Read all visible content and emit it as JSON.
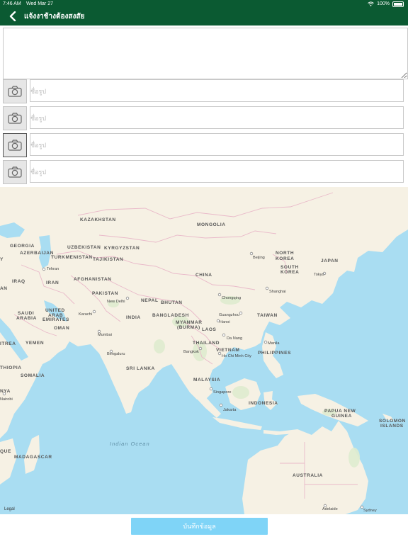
{
  "status_bar": {
    "time": "7:46 AM",
    "date": "Wed Mar 27",
    "battery": "100%"
  },
  "header": {
    "title": "แจ้งงาช้างต้องสงสัย"
  },
  "photos": {
    "rows": [
      {
        "placeholder": "ชื่อรูป"
      },
      {
        "placeholder": "ชื่อรูป"
      },
      {
        "placeholder": "ชื่อรูป"
      },
      {
        "placeholder": "ชื่อรูป"
      }
    ]
  },
  "map": {
    "countries": {
      "kazakhstan": "KAZAKHSTAN",
      "mongolia": "MONGOLIA",
      "georgia": "GEORGIA",
      "azerbaijan": "AZERBAIJAN",
      "uzbekistan": "UZBEKISTAN",
      "kyrgyzstan": "KYRGYZSTAN",
      "turkmenistan": "TURKMENISTAN",
      "tajikistan": "TAJIKISTAN",
      "iraq": "IRAQ",
      "iran": "IRAN",
      "afghanistan": "AFGHANISTAN",
      "pakistan": "PAKISTAN",
      "china": "CHINA",
      "north_korea_1": "NORTH",
      "north_korea_2": "KOREA",
      "south_korea_1": "SOUTH",
      "south_korea_2": "KOREA",
      "japan": "JAPAN",
      "nepal": "NEPAL",
      "bhutan": "BHUTAN",
      "saudi_1": "SAUDI",
      "saudi_2": "ARABIA",
      "uae_1": "UNITED",
      "uae_2": "ARAB",
      "uae_3": "EMIRATES",
      "india": "INDIA",
      "bangladesh": "BANGLADESH",
      "taiwan": "TAIWAN",
      "oman": "OMAN",
      "myanmar_1": "MYANMAR",
      "myanmar_2": "(BURMA)",
      "laos": "LAOS",
      "yemen": "YEMEN",
      "thailand": "THAILAND",
      "vietnam": "VIETNAM",
      "philippines": "PHILIPPINES",
      "eritrea": "ITREA",
      "ethiopia": "THIOPIA",
      "somalia": "SOMALIA",
      "sri_lanka": "SRI LANKA",
      "malaysia": "MALAYSIA",
      "kenya": "NYA",
      "indonesia": "INDONESIA",
      "png_1": "PAPUA NEW",
      "png_2": "GUINEA",
      "solomon_1": "SOLOMON",
      "solomon_2": "ISLANDS",
      "mozambique": "QUE",
      "madagascar": "MADAGASCAR",
      "australia": "AUSTRALIA",
      "y_fragment": "Y",
      "an_fragment": "AN"
    },
    "cities": {
      "beijing": "Beijing",
      "tokyo": "Tokyo",
      "tehran": "Tehran",
      "shanghai": "Shanghai",
      "chongqing": "Chongqing",
      "new_delhi": "New Delhi",
      "karachi": "Karachi",
      "guangzhou": "Guangzhou",
      "hanoi": "Hanoi",
      "mumbai": "Mumbai",
      "da_nang": "Da Nang",
      "manila": "Manila",
      "bangkok": "Bangkok",
      "hcmc": "Ho Chi Minh City",
      "bengaluru": "Bengaluru",
      "singapore": "Singapore",
      "jakarta": "Jakarta",
      "nairobi": "Nairobi",
      "adelaide": "Adelaide",
      "sydney": "Sydney"
    },
    "ocean": "Indian Ocean",
    "legal": "Legal"
  },
  "footer": {
    "save_label": "บันทึกข้อมูล"
  },
  "colors": {
    "header": "#0b5a32",
    "save_button": "#7fd4f7",
    "land": "#f6f1e4",
    "water": "#a9ddf2",
    "border": "#e9b9c9"
  }
}
